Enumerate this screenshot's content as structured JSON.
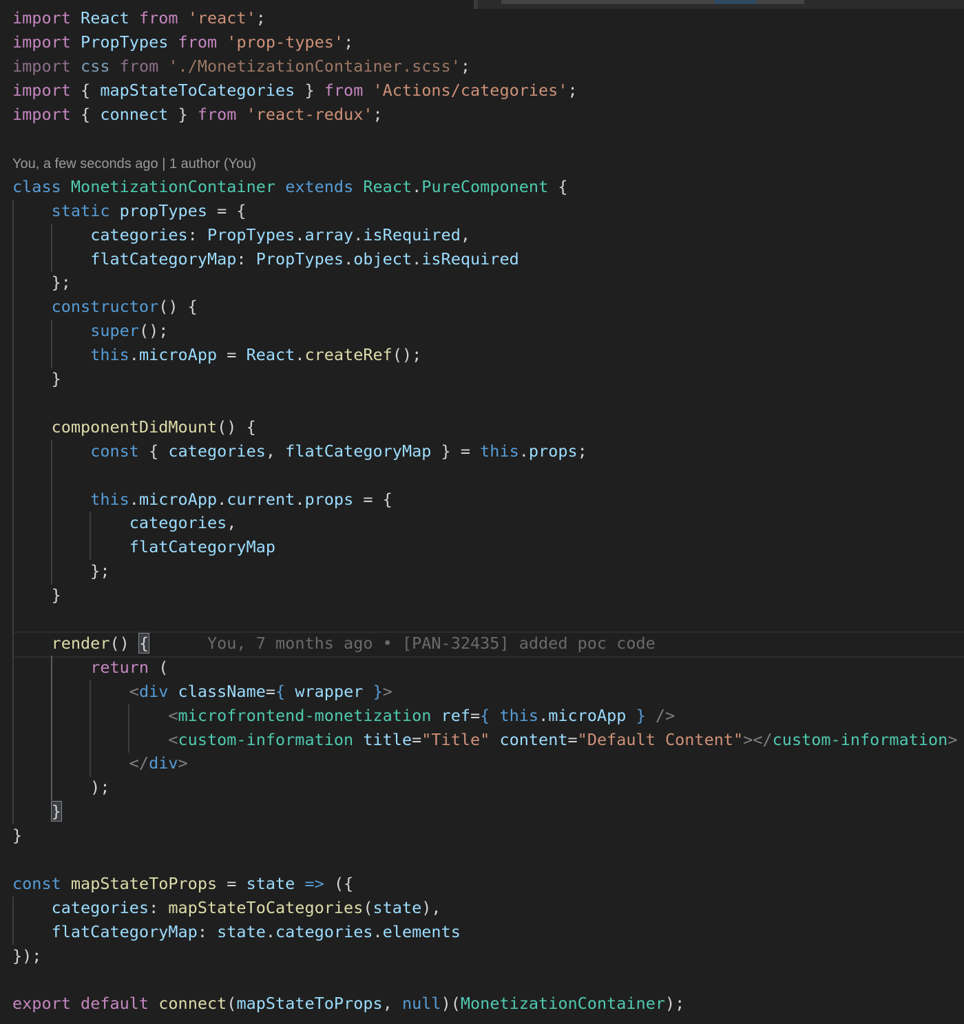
{
  "editor": {
    "blame_header": "You, a few seconds ago | 1 author (You)",
    "inline_blame": "You, 7 months ago • [PAN-32435] added poc code",
    "lines": {
      "l1": [
        "import",
        " ",
        "React",
        " ",
        "from",
        " ",
        "'react'",
        ";"
      ],
      "l2": [
        "import",
        " ",
        "PropTypes",
        " ",
        "from",
        " ",
        "'prop-types'",
        ";"
      ],
      "l3": [
        "import",
        " ",
        "css",
        " ",
        "from",
        " ",
        "'./MonetizationContainer.scss'",
        ";"
      ],
      "l4": [
        "import",
        " { ",
        "mapStateToCategories",
        " } ",
        "from",
        " ",
        "'Actions/categories'",
        ";"
      ],
      "l5": [
        "import",
        " { ",
        "connect",
        " } ",
        "from",
        " ",
        "'react-redux'",
        ";"
      ],
      "l7": [
        "class",
        " ",
        "MonetizationContainer",
        " ",
        "extends",
        " ",
        "React",
        ".",
        "PureComponent",
        " {"
      ],
      "l8": [
        "    ",
        "static",
        " ",
        "propTypes",
        " = {"
      ],
      "l9": [
        "        ",
        "categories",
        ": ",
        "PropTypes",
        ".",
        "array",
        ".",
        "isRequired",
        ","
      ],
      "l10": [
        "        ",
        "flatCategoryMap",
        ": ",
        "PropTypes",
        ".",
        "object",
        ".",
        "isRequired"
      ],
      "l11": [
        "    };"
      ],
      "l12": [
        "    ",
        "constructor",
        "() {"
      ],
      "l13": [
        "        ",
        "super",
        "();"
      ],
      "l14": [
        "        ",
        "this",
        ".",
        "microApp",
        " = ",
        "React",
        ".",
        "createRef",
        "();"
      ],
      "l15": [
        "    }"
      ],
      "l17": [
        "    ",
        "componentDidMount",
        "() {"
      ],
      "l18": [
        "        ",
        "const",
        " { ",
        "categories",
        ", ",
        "flatCategoryMap",
        " } = ",
        "this",
        ".",
        "props",
        ";"
      ],
      "l20": [
        "        ",
        "this",
        ".",
        "microApp",
        ".",
        "current",
        ".",
        "props",
        " = {"
      ],
      "l21": [
        "            ",
        "categories",
        ","
      ],
      "l22": [
        "            ",
        "flatCategoryMap"
      ],
      "l23": [
        "        };"
      ],
      "l24": [
        "    }"
      ],
      "l26": [
        "    ",
        "render",
        "() ",
        "{"
      ],
      "l27": [
        "        ",
        "return",
        " ("
      ],
      "l28": [
        "            ",
        "<",
        "div",
        " ",
        "className",
        "=",
        "{",
        " ",
        "wrapper",
        " ",
        "}",
        ">"
      ],
      "l29": [
        "                ",
        "<",
        "microfrontend-monetization",
        " ",
        "ref",
        "=",
        "{",
        " ",
        "this",
        ".",
        "microApp",
        " ",
        "}",
        " />"
      ],
      "l30": [
        "                ",
        "<",
        "custom-information",
        " ",
        "title",
        "=",
        "\"Title\"",
        " ",
        "content",
        "=",
        "\"Default Content\"",
        "></",
        "custom-information",
        ">"
      ],
      "l31": [
        "            ",
        "</",
        "div",
        ">"
      ],
      "l32": [
        "        );"
      ],
      "l33": [
        "    ",
        "}"
      ],
      "l34": [
        "}"
      ],
      "l36": [
        "const",
        " ",
        "mapStateToProps",
        " = ",
        "state",
        " ",
        "=>",
        " ({"
      ],
      "l37": [
        "    ",
        "categories",
        ": ",
        "mapStateToCategories",
        "(",
        "state",
        "),"
      ],
      "l38": [
        "    ",
        "flatCategoryMap",
        ": ",
        "state",
        ".",
        "categories",
        ".",
        "elements"
      ],
      "l39": [
        "});"
      ],
      "l41": [
        "export",
        " ",
        "default",
        " ",
        "connect",
        "(",
        "mapStateToProps",
        ", ",
        "null",
        ")(",
        "MonetizationContainer",
        ");"
      ]
    }
  }
}
